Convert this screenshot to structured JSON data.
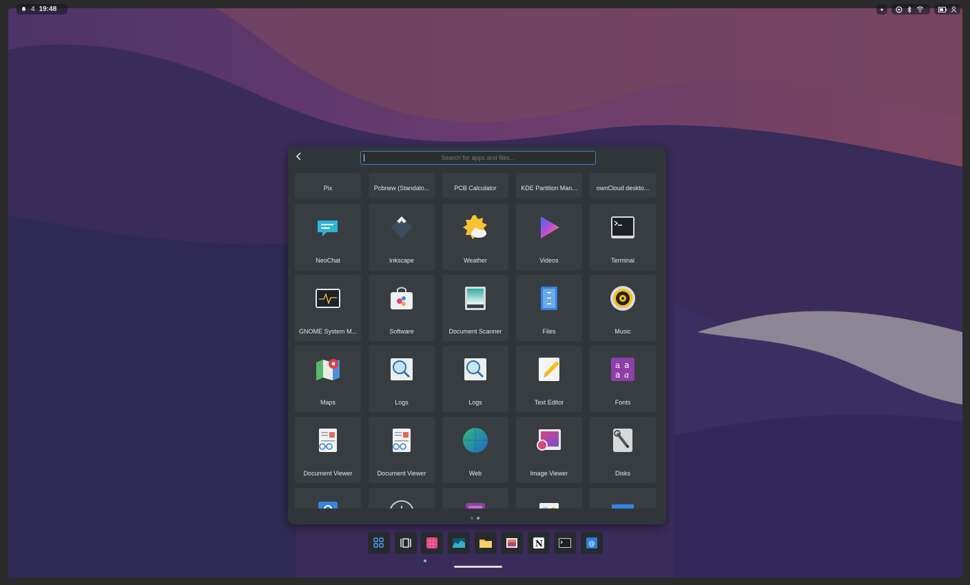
{
  "topbar": {
    "notification_count": "4",
    "time": "19:48"
  },
  "launcher": {
    "search_placeholder": "Search for apps and files...",
    "apps": [
      {
        "label": "Pix",
        "icon": "pix-icon"
      },
      {
        "label": "Pcbnew (Standalo...",
        "icon": "pcbnew-icon"
      },
      {
        "label": "PCB Calculator",
        "icon": "pcb-calculator-icon"
      },
      {
        "label": "KDE Partition Man...",
        "icon": "kde-partition-manager-icon"
      },
      {
        "label": "ownCloud deskto...",
        "icon": "owncloud-icon"
      },
      {
        "label": "NeoChat",
        "icon": "neochat-icon"
      },
      {
        "label": "Inkscape",
        "icon": "inkscape-icon"
      },
      {
        "label": "Weather",
        "icon": "weather-icon"
      },
      {
        "label": "Videos",
        "icon": "videos-icon"
      },
      {
        "label": "Terminal",
        "icon": "terminal-icon"
      },
      {
        "label": "GNOME System M...",
        "icon": "system-monitor-icon"
      },
      {
        "label": "Software",
        "icon": "software-icon"
      },
      {
        "label": "Document Scanner",
        "icon": "document-scanner-icon"
      },
      {
        "label": "Files",
        "icon": "files-icon"
      },
      {
        "label": "Music",
        "icon": "music-icon"
      },
      {
        "label": "Maps",
        "icon": "maps-icon"
      },
      {
        "label": "Logs",
        "icon": "logs-icon"
      },
      {
        "label": "Logs",
        "icon": "logs-icon"
      },
      {
        "label": "Text Editor",
        "icon": "text-editor-icon"
      },
      {
        "label": "Fonts",
        "icon": "fonts-icon"
      },
      {
        "label": "Document Viewer",
        "icon": "document-viewer-icon"
      },
      {
        "label": "Document Viewer",
        "icon": "document-viewer-icon"
      },
      {
        "label": "Web",
        "icon": "web-icon"
      },
      {
        "label": "Image Viewer",
        "icon": "image-viewer-icon"
      },
      {
        "label": "Disks",
        "icon": "disks-icon"
      }
    ],
    "partial_row_icons": [
      "contacts-icon",
      "clocks-icon",
      "screenshot-icon",
      "dictionary-icon",
      "calendar-icon"
    ],
    "page_count": 2,
    "current_page": 2
  },
  "dock": {
    "items": [
      "app-grid-icon",
      "workspaces-icon",
      "mosaic-app-icon",
      "system-monitor-graph-icon",
      "files-folder-icon",
      "image-viewer-icon",
      "notion-icon",
      "terminal-icon",
      "email-icon"
    ],
    "running_item": "mosaic-app-icon"
  },
  "colors": {
    "launcher_bg": "#303539",
    "tile_bg": "#383d41",
    "accent": "#3d7fc4"
  }
}
